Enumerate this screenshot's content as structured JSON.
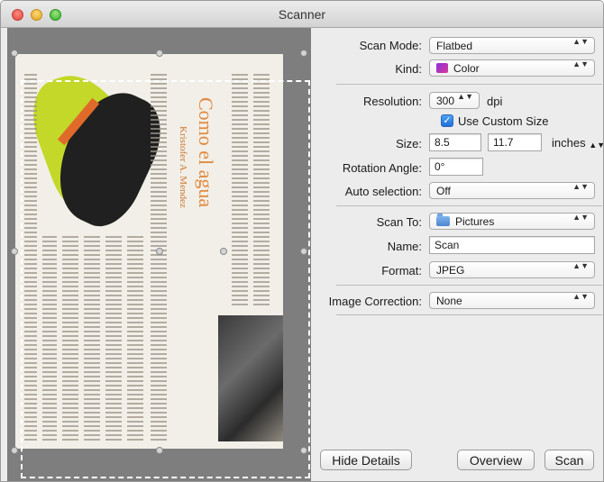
{
  "window": {
    "title": "Scanner"
  },
  "preview": {
    "headline": "Como el agua",
    "subline": "Kristofer A. Mendez"
  },
  "settings": {
    "scan_mode": {
      "label": "Scan Mode:",
      "value": "Flatbed"
    },
    "kind": {
      "label": "Kind:",
      "value": "Color"
    },
    "resolution": {
      "label": "Resolution:",
      "value": "300",
      "unit": "dpi"
    },
    "custom_size": {
      "label": "Use Custom Size",
      "checked": true
    },
    "size": {
      "label": "Size:",
      "width": "8.5",
      "height": "11.7",
      "unit": "inches"
    },
    "rotation": {
      "label": "Rotation Angle:",
      "value": "0°"
    },
    "auto_selection": {
      "label": "Auto selection:",
      "value": "Off"
    },
    "scan_to": {
      "label": "Scan To:",
      "value": "Pictures"
    },
    "name": {
      "label": "Name:",
      "value": "Scan"
    },
    "format": {
      "label": "Format:",
      "value": "JPEG"
    },
    "image_correction": {
      "label": "Image Correction:",
      "value": "None"
    }
  },
  "buttons": {
    "hide_details": "Hide Details",
    "overview": "Overview",
    "scan": "Scan"
  },
  "icons": {
    "popup_arrows": "▲▼",
    "checkmark": "✓",
    "stepper": "▲▼"
  }
}
